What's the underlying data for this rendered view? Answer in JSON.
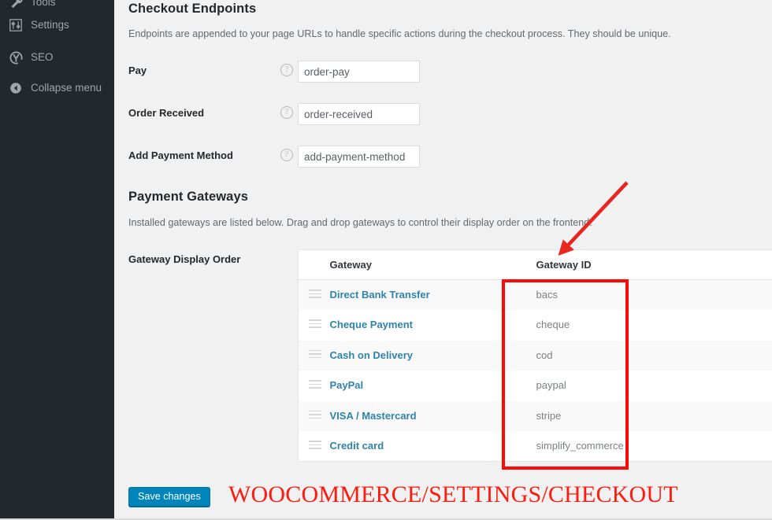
{
  "sidebar": {
    "items": [
      {
        "label": "Tools",
        "icon": "wrench-icon",
        "partial": true
      },
      {
        "label": "Settings",
        "icon": "sliders-icon",
        "partial": false
      },
      {
        "label": "SEO",
        "icon": "yoast-seo-icon",
        "partial": false
      }
    ],
    "collapse": {
      "label": "Collapse menu",
      "icon": "collapse-arrow-icon"
    },
    "background_color": "#23282d",
    "text_color": "#a0a5aa"
  },
  "checkout_endpoints": {
    "title": "Checkout Endpoints",
    "description": "Endpoints are appended to your page URLs to handle specific actions during the checkout process. They should be unique.",
    "fields": [
      {
        "label": "Pay",
        "value": "order-pay",
        "help": "?"
      },
      {
        "label": "Order Received",
        "value": "order-received",
        "help": "?"
      },
      {
        "label": "Add Payment Method",
        "value": "add-payment-method",
        "help": "?"
      }
    ]
  },
  "payment_gateways": {
    "title": "Payment Gateways",
    "description": "Installed gateways are listed below. Drag and drop gateways to control their display order on the frontend.",
    "order_label": "Gateway Display Order",
    "columns": [
      "",
      "Gateway",
      "Gateway ID"
    ],
    "rows": [
      {
        "name": "Direct Bank Transfer",
        "id": "bacs"
      },
      {
        "name": "Cheque Payment",
        "id": "cheque"
      },
      {
        "name": "Cash on Delivery",
        "id": "cod"
      },
      {
        "name": "PayPal",
        "id": "paypal"
      },
      {
        "name": "VISA / Mastercard",
        "id": "stripe"
      },
      {
        "name": "Credit card",
        "id": "simplify_commerce"
      }
    ],
    "link_color": "#2f83ad"
  },
  "actions": {
    "save_label": "Save changes",
    "save_color": "#0085ba"
  },
  "annotations": {
    "caption": "WOOCOMMERCE/SETTINGS/CHECKOUT",
    "highlight_color": "#fc0a0a",
    "arrow": "points-to-gateway-id-column"
  }
}
